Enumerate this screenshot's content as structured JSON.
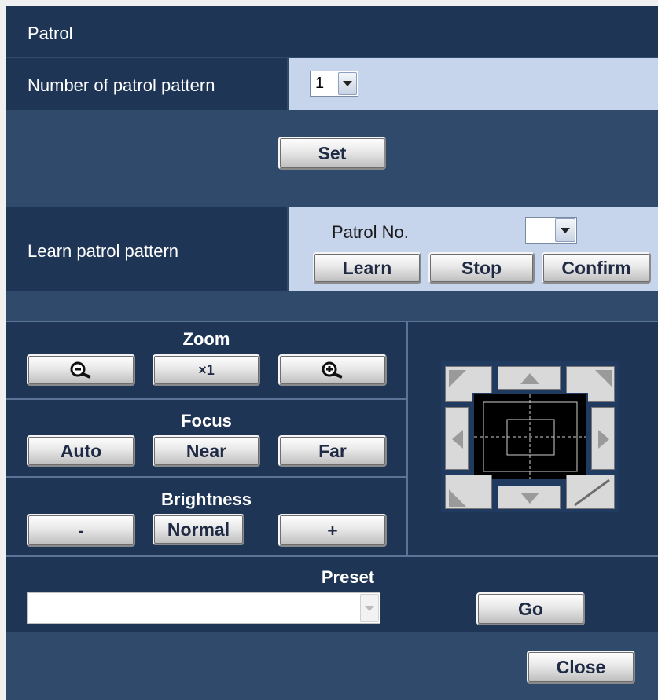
{
  "window": {
    "title": "Patrol"
  },
  "patrol_count": {
    "label": "Number of patrol pattern",
    "value": "1"
  },
  "set_button": "Set",
  "learn": {
    "label": "Learn patrol pattern",
    "patrol_no_label": "Patrol No.",
    "patrol_no_value": "",
    "learn_button": "Learn",
    "stop_button": "Stop",
    "confirm_button": "Confirm"
  },
  "zoom": {
    "label": "Zoom",
    "reset_button": "×1",
    "zoom_out_icon": "zoom-out-icon",
    "zoom_in_icon": "zoom-in-icon"
  },
  "focus": {
    "label": "Focus",
    "auto_button": "Auto",
    "near_button": "Near",
    "far_button": "Far"
  },
  "brightness": {
    "label": "Brightness",
    "minus_button": "-",
    "normal_button": "Normal",
    "plus_button": "+"
  },
  "preset": {
    "label": "Preset",
    "value": "",
    "go_button": "Go"
  },
  "close_button": "Close",
  "colors": {
    "panel_bg": "#2f4a6b",
    "header_bg": "#1f3556",
    "field_bg": "#c6d5ec"
  }
}
